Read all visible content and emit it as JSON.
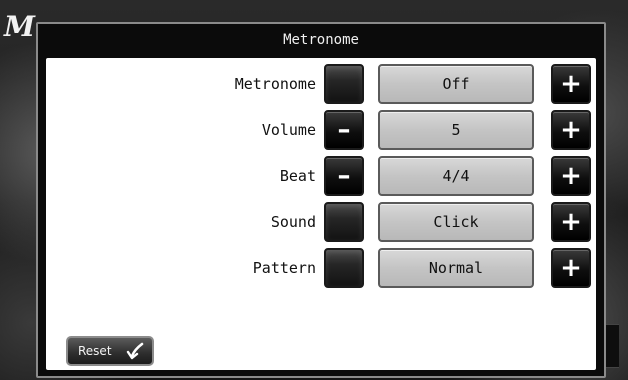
{
  "app": {
    "logo_text": "M"
  },
  "dialog": {
    "title": "Metronome"
  },
  "rows": [
    {
      "label": "Metronome",
      "value": "Off",
      "decrement_enabled": false,
      "increment_enabled": true
    },
    {
      "label": "Volume",
      "value": "5",
      "decrement_enabled": true,
      "increment_enabled": true
    },
    {
      "label": "Beat",
      "value": "4/4",
      "decrement_enabled": true,
      "increment_enabled": true
    },
    {
      "label": "Sound",
      "value": "Click",
      "decrement_enabled": false,
      "increment_enabled": true
    },
    {
      "label": "Pattern",
      "value": "Normal",
      "decrement_enabled": false,
      "increment_enabled": true
    }
  ],
  "icons": {
    "decrement": "minus-icon",
    "increment": "plus-icon",
    "reset": "undo-arrow-icon"
  },
  "reset": {
    "label": "Reset"
  }
}
